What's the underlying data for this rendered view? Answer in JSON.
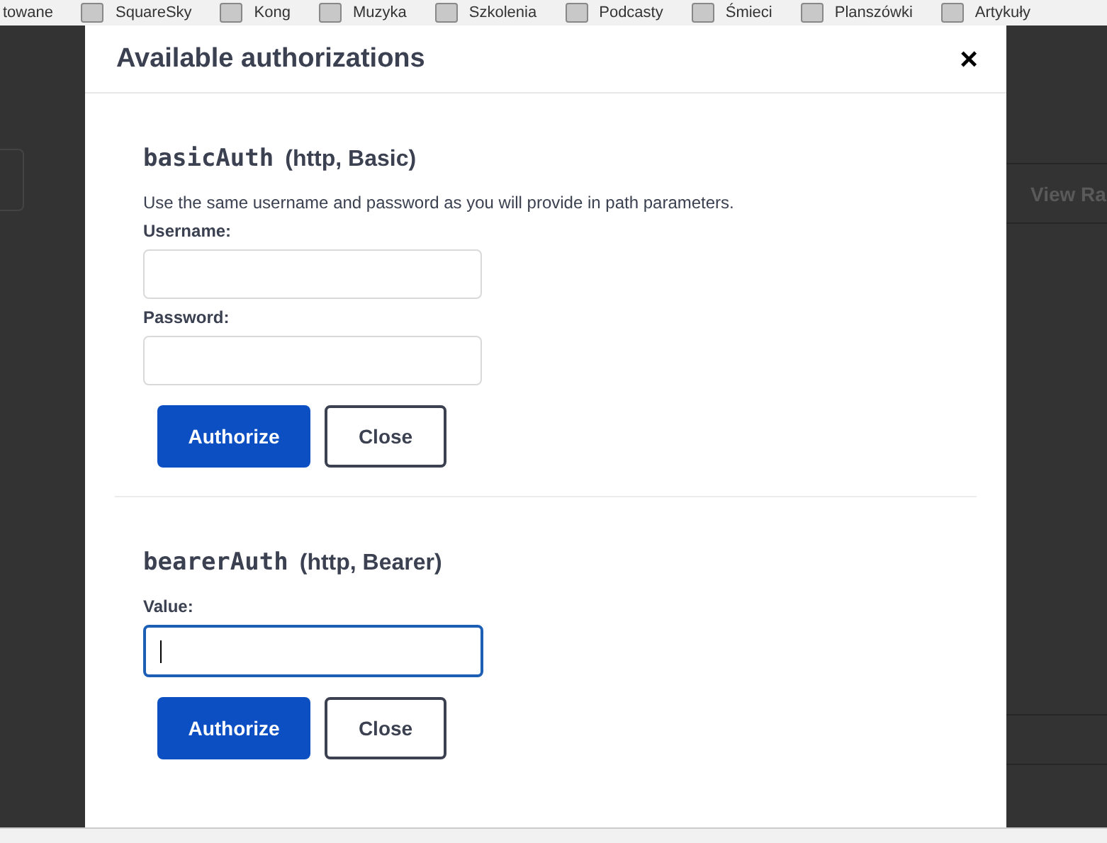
{
  "bookmarks": [
    {
      "label": "towane",
      "icon": false
    },
    {
      "label": "SquareSky",
      "icon": true
    },
    {
      "label": "Kong",
      "icon": true
    },
    {
      "label": "Muzyka",
      "icon": true
    },
    {
      "label": "Szkolenia",
      "icon": true
    },
    {
      "label": "Podcasty",
      "icon": true
    },
    {
      "label": "Śmieci",
      "icon": true
    },
    {
      "label": "Planszówki",
      "icon": true
    },
    {
      "label": "Artykuły",
      "icon": true
    }
  ],
  "background": {
    "column_text": "View Ra"
  },
  "dialog": {
    "title": "Available authorizations",
    "close": "×",
    "schemes": [
      {
        "name": "basicAuth",
        "type": "(http, Basic)",
        "description": "Use the same username and password as you will provide in path parameters.",
        "fields": [
          {
            "label": "Username:",
            "focused": false
          },
          {
            "label": "Password:",
            "focused": false
          }
        ],
        "authorize": "Authorize",
        "close": "Close"
      },
      {
        "name": "bearerAuth",
        "type": "(http, Bearer)",
        "fields": [
          {
            "label": "Value:",
            "focused": true
          }
        ],
        "authorize": "Authorize",
        "close": "Close"
      }
    ]
  }
}
